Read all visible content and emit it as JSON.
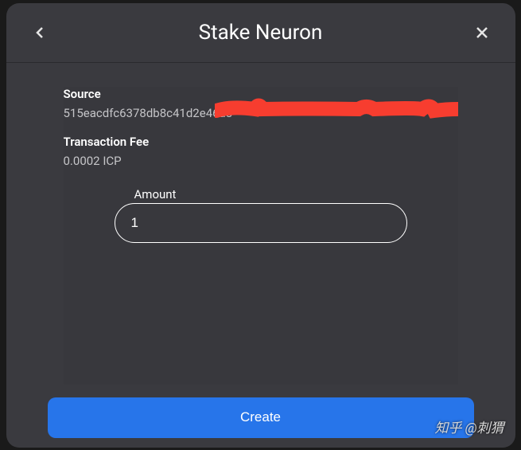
{
  "header": {
    "title": "Stake Neuron"
  },
  "source": {
    "label": "Source",
    "value": "515eacdfc6378db8c41d2e46a8"
  },
  "fee": {
    "label": "Transaction Fee",
    "value": "0.0002 ICP"
  },
  "amount": {
    "label": "Amount",
    "value": "1"
  },
  "footer": {
    "create_label": "Create"
  },
  "watermark": "知乎 @刺猬"
}
